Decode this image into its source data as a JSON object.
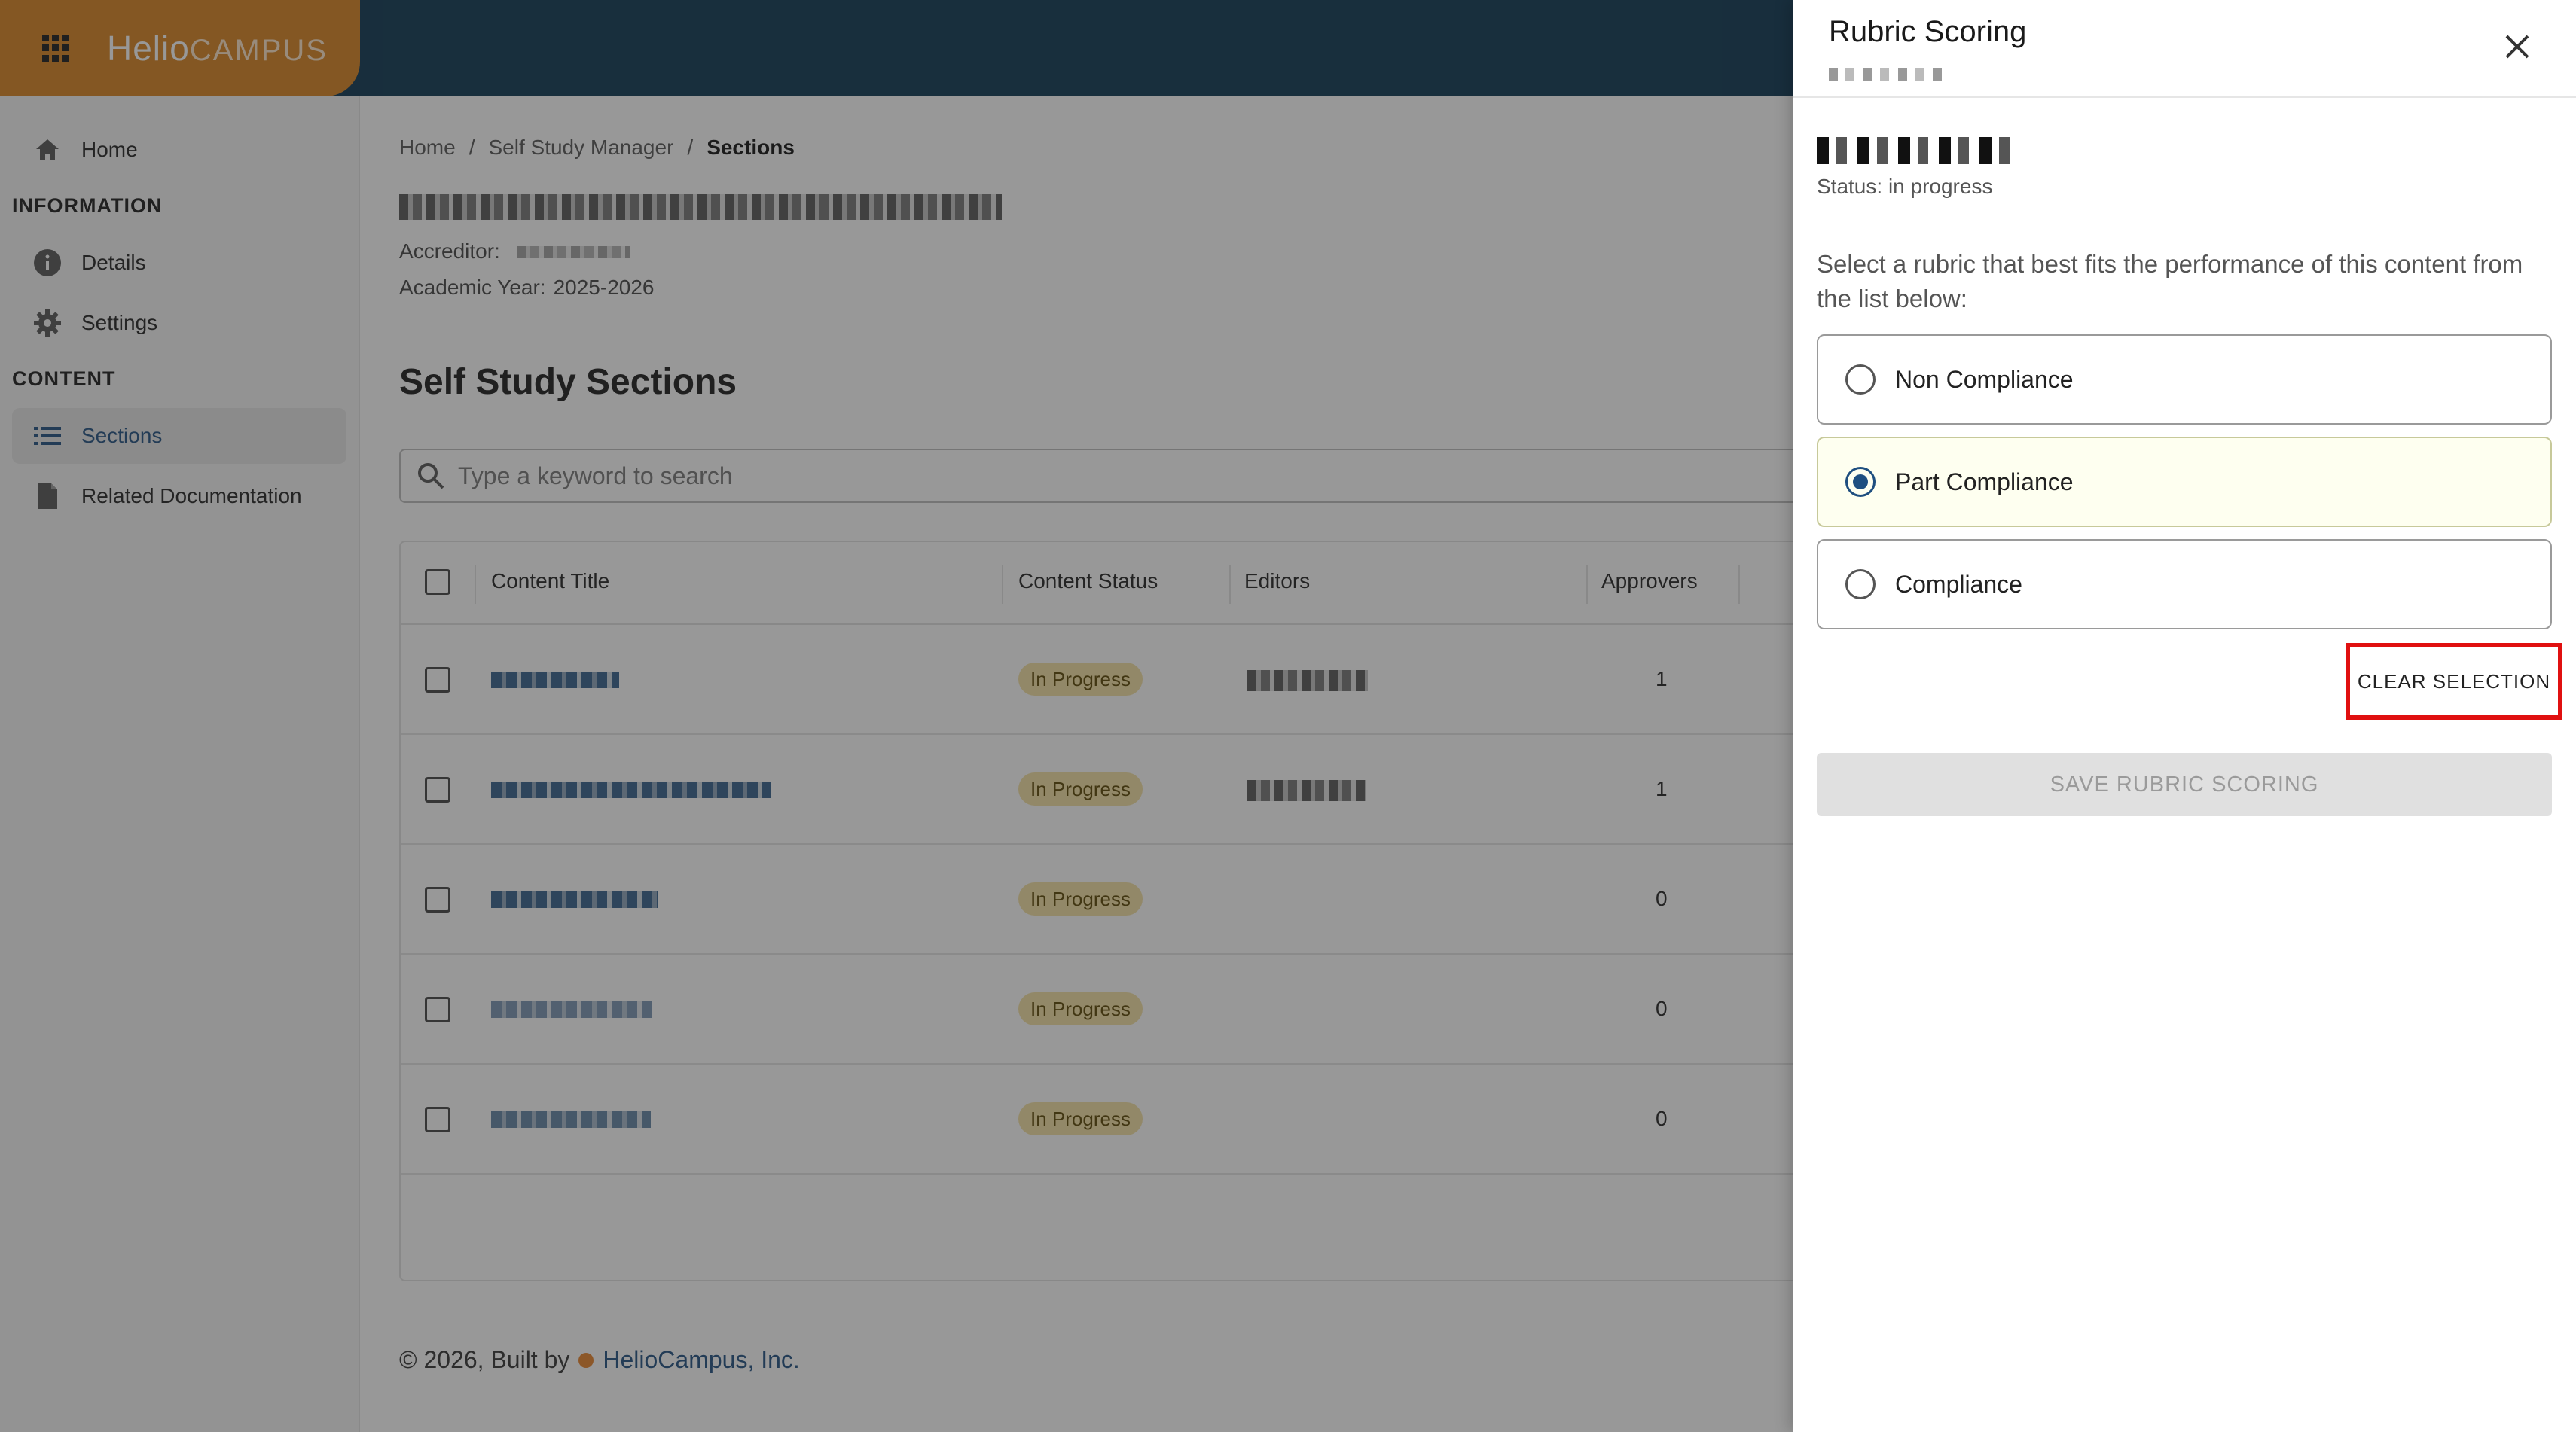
{
  "brand": {
    "name_main": "Helio",
    "name_sub": "CAMPUS"
  },
  "sidebar": {
    "home": "Home",
    "section_information": "INFORMATION",
    "details": "Details",
    "settings": "Settings",
    "section_content": "CONTENT",
    "sections": "Sections",
    "related_documentation": "Related Documentation"
  },
  "breadcrumb": {
    "home": "Home",
    "sep1": "/",
    "manager": "Self Study Manager",
    "sep2": "/",
    "current": "Sections"
  },
  "meta": {
    "accreditor_label": "Accreditor:",
    "year_label": "Academic Year:",
    "year_value": "2025-2026"
  },
  "main": {
    "section_title": "Self Study Sections"
  },
  "search": {
    "placeholder": "Type a keyword to search"
  },
  "table": {
    "headers": {
      "title": "Content Title",
      "status": "Content Status",
      "editors": "Editors",
      "approvers": "Approvers"
    },
    "rows": [
      {
        "status": "In Progress",
        "approvers": "1"
      },
      {
        "status": "In Progress",
        "approvers": "1"
      },
      {
        "status": "In Progress",
        "approvers": "0"
      },
      {
        "status": "In Progress",
        "approvers": "0"
      },
      {
        "status": "In Progress",
        "approvers": "0"
      }
    ]
  },
  "footer": {
    "text": "© 2026, Built by",
    "link": "HelioCampus, Inc."
  },
  "drawer": {
    "title": "Rubric Scoring",
    "status": "Status: in progress",
    "instruction": "Select a rubric that best fits the performance of this content from the list below:",
    "options": [
      {
        "label": "Non Compliance",
        "selected": false
      },
      {
        "label": "Part Compliance",
        "selected": true
      },
      {
        "label": "Compliance",
        "selected": false
      }
    ],
    "clear_label": "CLEAR SELECTION",
    "save_label": "SAVE RUBRIC SCORING"
  },
  "colors": {
    "topbar": "#0a3551",
    "brand": "#d9821f",
    "accent": "#1f4f80",
    "pill": "#f4e0a3",
    "highlight": "#e01010"
  }
}
